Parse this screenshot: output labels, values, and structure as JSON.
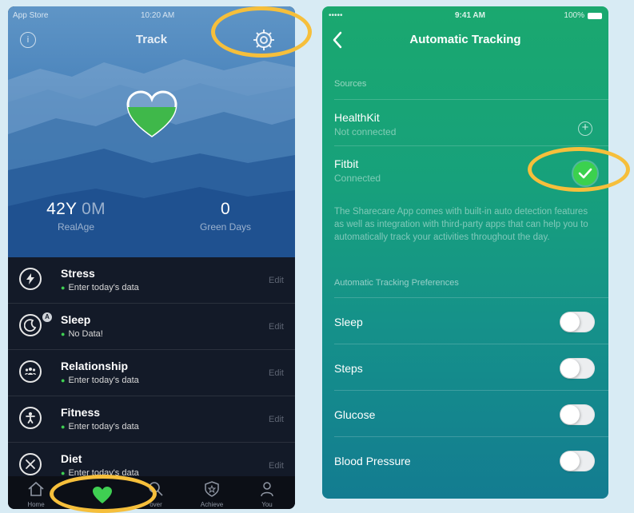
{
  "left": {
    "status": {
      "carrier": "App Store",
      "time": "10:20 AM"
    },
    "info_glyph": "i",
    "title": "Track",
    "real_age": {
      "value_main": "42Y",
      "value_dim": " 0M",
      "label": "RealAge"
    },
    "green_days": {
      "value": "0",
      "label": "Green Days"
    },
    "items": [
      {
        "title": "Stress",
        "status": "Enter today's data",
        "edit": "Edit",
        "icon": "lightning-icon"
      },
      {
        "title": "Sleep",
        "status": "No Data!",
        "edit": "Edit",
        "icon": "moon-icon",
        "badge": "A"
      },
      {
        "title": "Relationship",
        "status": "Enter today's data",
        "edit": "Edit",
        "icon": "people-icon"
      },
      {
        "title": "Fitness",
        "status": "Enter today's data",
        "edit": "Edit",
        "icon": "person-icon"
      },
      {
        "title": "Diet",
        "status": "Enter today's data",
        "edit": "Edit",
        "icon": "close-icon"
      }
    ],
    "tabs": [
      {
        "label": "Home",
        "icon": "home-icon"
      },
      {
        "label": "",
        "icon": "heart-icon"
      },
      {
        "label": "over",
        "icon": "search-icon"
      },
      {
        "label": "Achieve",
        "icon": "shield-star-icon"
      },
      {
        "label": "You",
        "icon": "user-icon"
      }
    ]
  },
  "right": {
    "status": {
      "signal": "•••••",
      "time": "9:41 AM",
      "battery": "100%"
    },
    "title": "Automatic Tracking",
    "sources_header": "Sources",
    "sources": [
      {
        "title": "HealthKit",
        "status": "Not connected",
        "action": "add"
      },
      {
        "title": "Fitbit",
        "status": "Connected",
        "action": "connected"
      }
    ],
    "description": "The Sharecare App comes with built-in auto detection features as well as integration with third-party apps that can help you to automatically track your activities throughout the day.",
    "prefs_header": "Automatic Tracking Preferences",
    "preferences": [
      {
        "label": "Sleep",
        "enabled": false
      },
      {
        "label": "Steps",
        "enabled": false
      },
      {
        "label": "Glucose",
        "enabled": false
      },
      {
        "label": "Blood Pressure",
        "enabled": false
      }
    ]
  },
  "colors": {
    "highlight": "#f6bf3b",
    "heart_green": "#3fb84a",
    "check_green": "#3bd14e",
    "teal_top": "#1aa86f",
    "teal_bottom": "#137c91",
    "dark_list": "#131a28"
  }
}
